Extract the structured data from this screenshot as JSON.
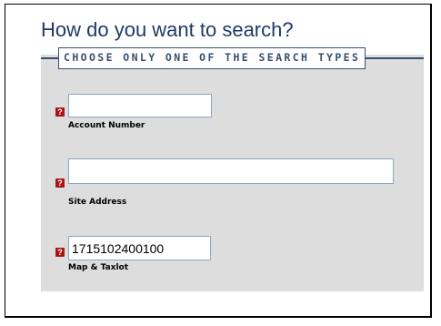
{
  "form": {
    "title": "How do you want to search?",
    "legend": "CHOOSE ONLY ONE OF THE SEARCH TYPES",
    "help_glyph": "?",
    "account_number": {
      "label": "Account Number",
      "value": ""
    },
    "site_address": {
      "label": "Site Address",
      "value": ""
    },
    "map_taxlot": {
      "label": "Map & Taxlot",
      "value": "1715102400100"
    }
  },
  "colors": {
    "title": "#1f3a66",
    "legend": "#37506e",
    "panel": "#dddddd",
    "help_icon": "#a81515",
    "field_border": "#8fa6c4"
  },
  "icons": [
    "help-icon"
  ]
}
